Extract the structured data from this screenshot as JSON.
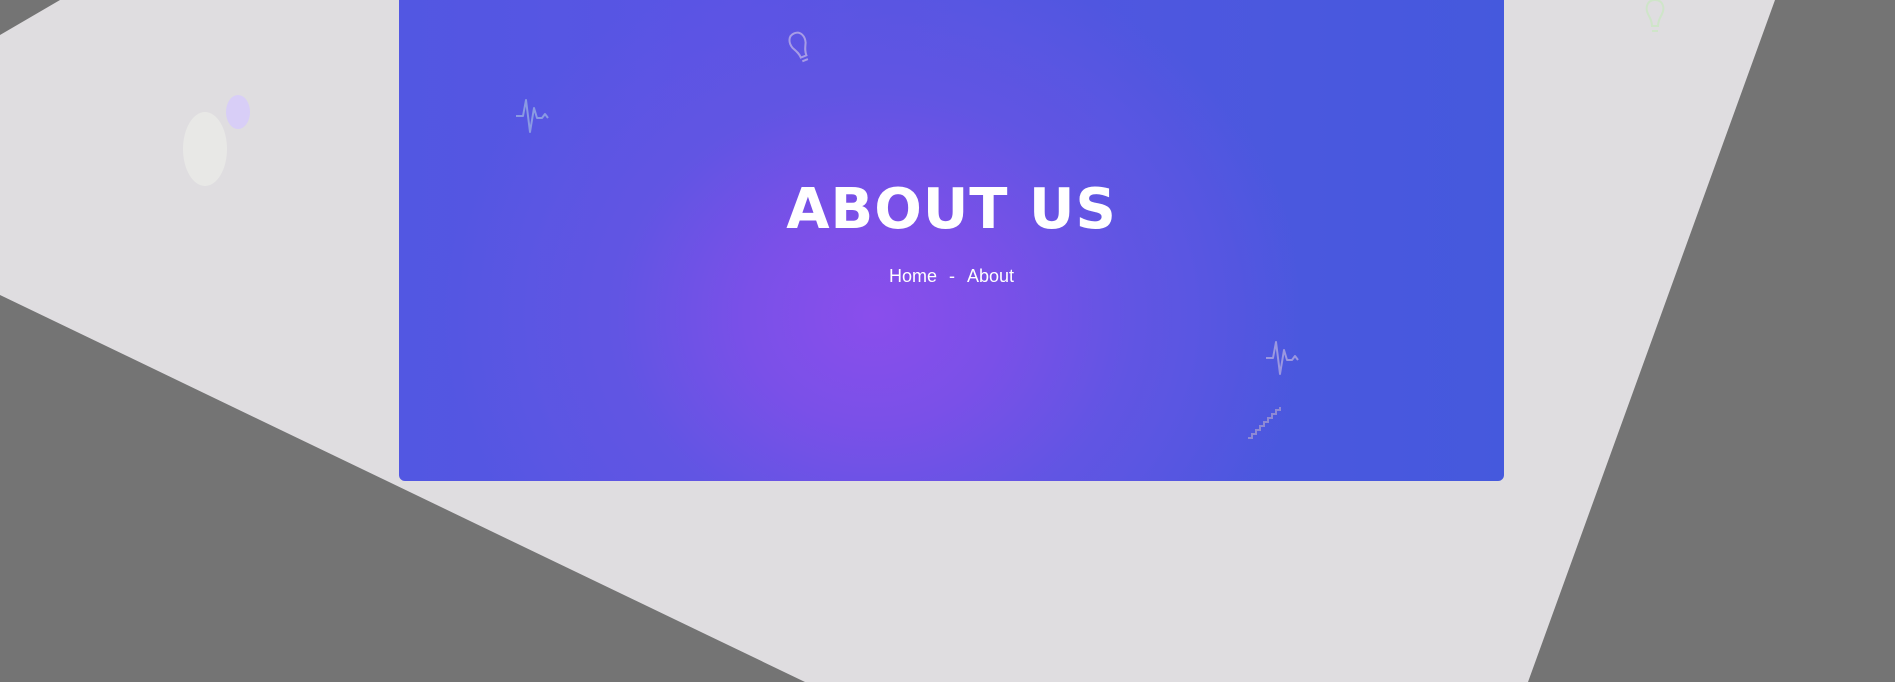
{
  "hero": {
    "title": "ABOUT US"
  },
  "breadcrumb": {
    "home": "Home",
    "separator": "-",
    "current": "About"
  },
  "colors": {
    "hero_gradient_center": "#8a4eec",
    "hero_gradient_edge": "#4559dd",
    "page_light": "#dfdde0",
    "page_dark": "#747474",
    "text": "#ffffff"
  },
  "icons": [
    "pulse-icon",
    "lightbulb-icon",
    "ellipse-icon",
    "ladder-icon"
  ]
}
